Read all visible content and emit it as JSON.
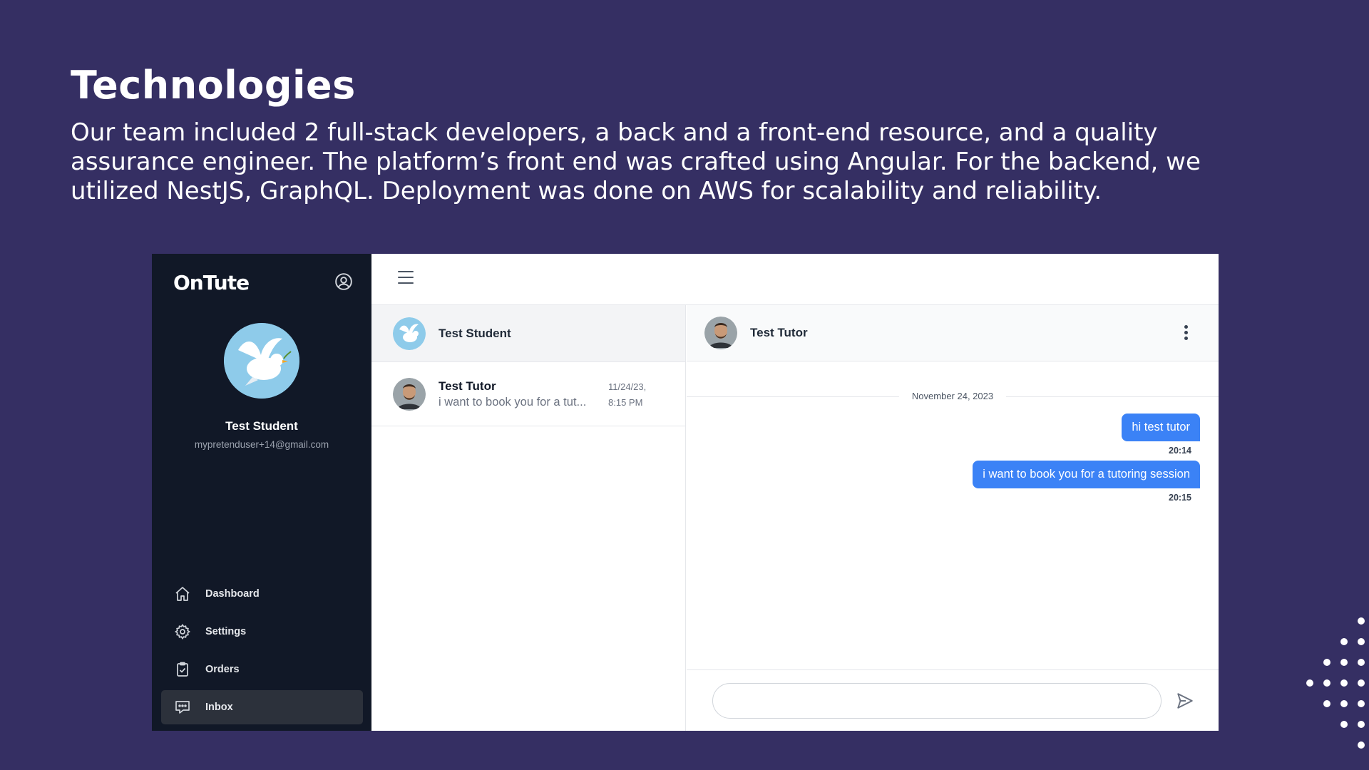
{
  "slide": {
    "title": "Technologies",
    "description": "Our team included 2 full-stack developers, a back and a front-end resource, and a quality assurance engineer. The platform’s front end was crafted using Angular. For the backend, we utilized NestJS, GraphQL. Deployment was done on AWS for scalability and reliability."
  },
  "app": {
    "logo": "OnTute",
    "profile": {
      "name": "Test Student",
      "email": "mypretenduser+14@gmail.com"
    },
    "nav": [
      {
        "label": "Dashboard",
        "icon": "home-icon"
      },
      {
        "label": "Settings",
        "icon": "gear-icon"
      },
      {
        "label": "Orders",
        "icon": "clipboard-check-icon"
      },
      {
        "label": "Inbox",
        "icon": "chat-icon",
        "active": true
      }
    ],
    "conversations": {
      "current_user": "Test Student",
      "items": [
        {
          "name": "Test Tutor",
          "preview": "i want to book you for a tut...",
          "date": "11/24/23,",
          "time": "8:15 PM"
        }
      ]
    },
    "chat": {
      "contact": "Test Tutor",
      "date_separator": "November 24, 2023",
      "messages": [
        {
          "text": "hi test tutor",
          "time": "20:14"
        },
        {
          "text": "i want to book you for a tutoring session",
          "time": "20:15"
        }
      ],
      "input_placeholder": ""
    },
    "colors": {
      "sidebar": "#111827",
      "bubble": "#3b82f6",
      "slide_background": "#352f63"
    }
  }
}
